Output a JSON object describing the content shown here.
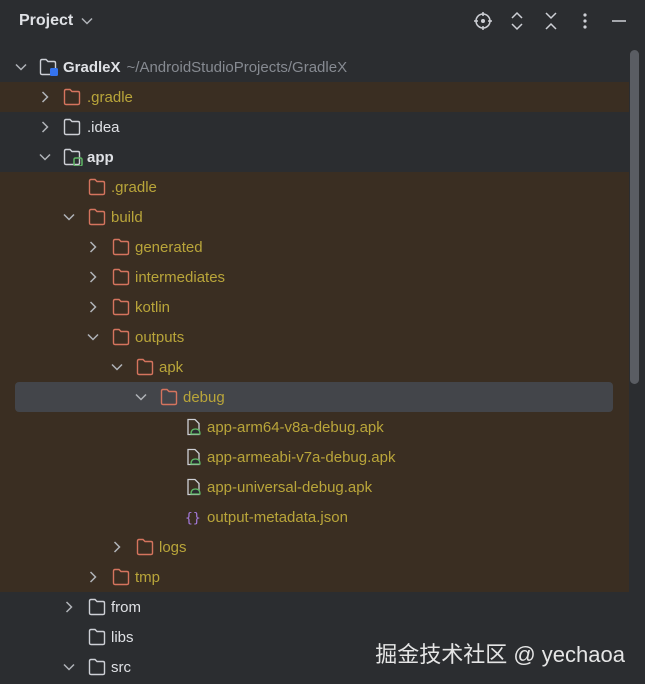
{
  "header": {
    "title": "Project"
  },
  "root": {
    "name": "GradleX",
    "path": "~/AndroidStudioProjects/GradleX"
  },
  "tree": {
    "gradle_root": ".gradle",
    "idea": ".idea",
    "app": "app",
    "app_gradle": ".gradle",
    "build": "build",
    "generated": "generated",
    "intermediates": "intermediates",
    "kotlin": "kotlin",
    "outputs": "outputs",
    "apk": "apk",
    "debug": "debug",
    "apk1": "app-arm64-v8a-debug.apk",
    "apk2": "app-armeabi-v7a-debug.apk",
    "apk3": "app-universal-debug.apk",
    "metadata": "output-metadata.json",
    "logs": "logs",
    "tmp": "tmp",
    "from": "from",
    "libs": "libs",
    "src": "src"
  },
  "watermark": "掘金技术社区 @ yechaoa",
  "colors": {
    "background": "#2b2d30",
    "excluded_row": "#3a2e22",
    "selected_row": "#43454a",
    "excluded_text": "#b9a53a",
    "excluded_folder": "#d5745e",
    "normal_text": "#dfe1e5",
    "path_text": "#868a91",
    "module_badge_blue": "#3574f0",
    "module_badge_green": "#5fb865",
    "json_icon": "#a77ce0"
  }
}
